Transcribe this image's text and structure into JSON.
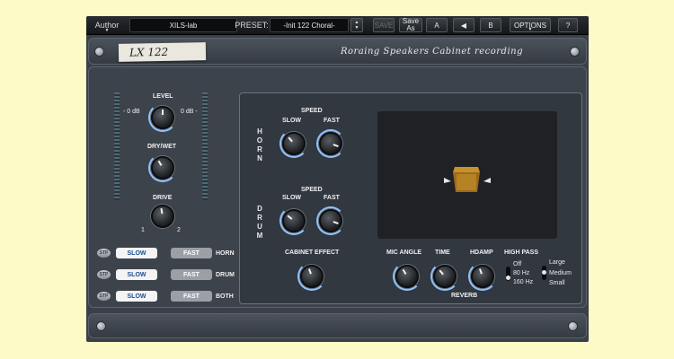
{
  "toolbar": {
    "author": "Author",
    "preset_name": "XILS-lab",
    "preset_label": "PRESET:",
    "preset_value": "-Init 122 Choral-",
    "save": "SAVE",
    "save_as_1": "Save",
    "save_as_2": "As",
    "a": "A",
    "b": "B",
    "options": "OPTIONS",
    "help": "?"
  },
  "header": {
    "tape_label": "LX 122",
    "subtitle": "Roraing Speakers Cabinet recording"
  },
  "left": {
    "level": "LEVEL",
    "db_left": "- 0 dB",
    "db_right": "0 dB -",
    "drywet": "DRY/WET",
    "drive": "DRIVE",
    "drive_min": "1",
    "drive_max": "2",
    "rows": [
      {
        "stp": "STP",
        "slow": "SLOW",
        "fast": "FAST",
        "name": "HORN"
      },
      {
        "stp": "STP",
        "slow": "SLOW",
        "fast": "FAST",
        "name": "DRUM"
      },
      {
        "stp": "STP",
        "slow": "SLOW",
        "fast": "FAST",
        "name": "BOTH"
      }
    ]
  },
  "horn": {
    "letters": [
      "H",
      "O",
      "R",
      "N"
    ],
    "speed": "SPEED",
    "slow": "SLOW",
    "fast": "FAST"
  },
  "drum": {
    "letters": [
      "D",
      "R",
      "U",
      "M"
    ],
    "speed": "SPEED",
    "slow": "SLOW",
    "fast": "FAST"
  },
  "cabinet_effect": "CABINET EFFECT",
  "reverb": {
    "mic_angle": "MIC ANGLE",
    "time": "TIME",
    "hdamp": "HDAMP",
    "title": "REVERB"
  },
  "high_pass": {
    "title": "HIGH PASS",
    "options": [
      "Off",
      "80 Hz",
      "160 Hz"
    ]
  },
  "size": {
    "options": [
      "Large",
      "Medium",
      "Small"
    ]
  },
  "colors": {
    "accent_ring": "#8fc2ff",
    "panel": "#3a4048",
    "background": "#fdfac8"
  }
}
